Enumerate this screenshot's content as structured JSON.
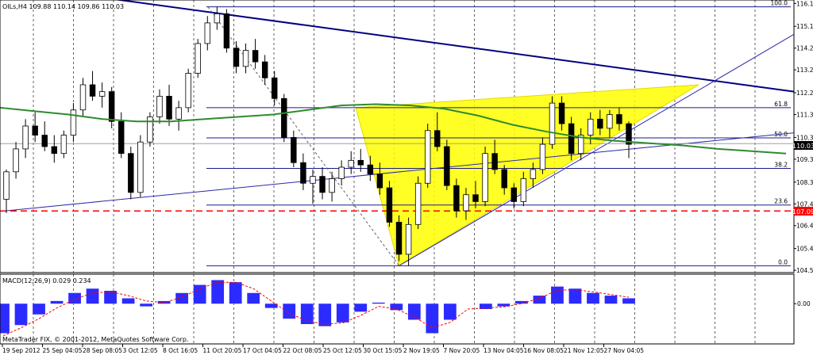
{
  "chart_data": [
    {
      "type": "candlestick",
      "title": "OILs,H4  109.88 110.14 109.86 110.03",
      "watermark": "MetaTrader FIX, © 2001-2012, MetaQuotes Software Corp.",
      "ylim": [
        104.4,
        116.3
      ],
      "y_ticks": [
        "116.15",
        "115.15",
        "114.20",
        "113.25",
        "112.25",
        "111.30",
        "110.30",
        "109.35",
        "108.35",
        "107.40",
        "106.45",
        "105.45",
        "104.50"
      ],
      "x_ticks": [
        "19 Sep 2012",
        "25 Sep 04:05",
        "28 Sep 08:05",
        "3 Oct 12:05",
        "8 Oct 16:05",
        "11 Oct 20:05",
        "17 Oct 04:05",
        "22 Oct 08:05",
        "25 Oct 12:05",
        "30 Oct 15:05",
        "2 Nov 19:05",
        "7 Nov 20:05",
        "13 Nov 04:05",
        "16 Nov 08:05",
        "21 Nov 12:05",
        "27 Nov 04:05"
      ],
      "current_price": {
        "value": 110.03,
        "label": "110.03"
      },
      "support_line": {
        "value": 107.09,
        "label": "107.09",
        "color": "#ff0000"
      },
      "moving_average": {
        "color": "#2e8b2e",
        "values": [
          111.6,
          111.45,
          111.3,
          111.1,
          111.0,
          111.0,
          111.1,
          111.2,
          111.3,
          111.5,
          111.7,
          111.75,
          111.7,
          111.55,
          111.25,
          110.85,
          110.55,
          110.3,
          110.15,
          110.05,
          109.95,
          109.8,
          109.7,
          109.6
        ]
      },
      "fibonacci": [
        {
          "level": "100.0",
          "price": 116.0
        },
        {
          "level": "61.8",
          "price": 111.6
        },
        {
          "level": "50.0",
          "price": 110.28
        },
        {
          "level": "38.2",
          "price": 108.95
        },
        {
          "level": "23.6",
          "price": 107.35
        },
        {
          "level": "0.0",
          "price": 104.7
        }
      ],
      "series": [
        {
          "values": [
            [
              107.6,
              108.9,
              107.0,
              108.8
            ],
            [
              108.8,
              110.1,
              108.5,
              109.8
            ],
            [
              109.8,
              111.1,
              109.4,
              110.8
            ],
            [
              110.8,
              111.4,
              110.1,
              110.4
            ],
            [
              110.4,
              111.0,
              109.7,
              109.9
            ],
            [
              109.9,
              110.4,
              109.2,
              109.6
            ],
            [
              109.6,
              110.6,
              109.4,
              110.4
            ],
            [
              110.4,
              111.8,
              110.1,
              111.5
            ],
            [
              111.5,
              112.9,
              111.2,
              112.6
            ],
            [
              112.6,
              113.2,
              111.9,
              112.1
            ],
            [
              112.1,
              112.7,
              111.6,
              112.3
            ],
            [
              112.3,
              112.5,
              110.7,
              111.0
            ],
            [
              111.0,
              111.4,
              109.4,
              109.6
            ],
            [
              109.6,
              109.9,
              107.6,
              107.9
            ],
            [
              107.9,
              110.4,
              107.7,
              110.1
            ],
            [
              110.1,
              111.4,
              109.9,
              111.2
            ],
            [
              111.2,
              112.4,
              110.9,
              112.1
            ],
            [
              112.1,
              112.6,
              110.8,
              111.1
            ],
            [
              111.1,
              111.9,
              110.6,
              111.6
            ],
            [
              111.6,
              113.3,
              111.4,
              113.1
            ],
            [
              113.1,
              114.6,
              112.9,
              114.4
            ],
            [
              114.4,
              115.6,
              114.1,
              115.3
            ],
            [
              115.3,
              116.0,
              115.0,
              115.7
            ],
            [
              115.7,
              115.9,
              114.0,
              114.2
            ],
            [
              114.2,
              114.5,
              113.1,
              113.4
            ],
            [
              113.4,
              114.4,
              113.1,
              114.1
            ],
            [
              114.1,
              114.6,
              113.3,
              113.6
            ],
            [
              113.6,
              113.9,
              112.6,
              112.9
            ],
            [
              112.9,
              113.2,
              111.7,
              112.0
            ],
            [
              112.0,
              112.2,
              110.1,
              110.3
            ],
            [
              110.3,
              110.6,
              109.0,
              109.2
            ],
            [
              109.2,
              109.6,
              108.0,
              108.3
            ],
            [
              108.3,
              108.9,
              107.4,
              108.6
            ],
            [
              108.6,
              109.0,
              107.6,
              107.9
            ],
            [
              107.9,
              108.8,
              107.5,
              108.5
            ],
            [
              108.5,
              109.3,
              108.2,
              109.0
            ],
            [
              109.0,
              109.7,
              108.7,
              109.3
            ],
            [
              109.3,
              109.8,
              108.8,
              109.1
            ],
            [
              109.1,
              109.5,
              108.4,
              108.7
            ],
            [
              108.7,
              109.2,
              107.8,
              108.1
            ],
            [
              108.1,
              108.4,
              106.4,
              106.6
            ],
            [
              106.6,
              106.9,
              104.9,
              105.2
            ],
            [
              105.2,
              106.8,
              104.7,
              106.5
            ],
            [
              106.5,
              108.6,
              106.3,
              108.3
            ],
            [
              108.3,
              110.9,
              108.1,
              110.6
            ],
            [
              110.6,
              111.4,
              109.7,
              109.9
            ],
            [
              109.9,
              110.2,
              108.0,
              108.2
            ],
            [
              108.2,
              108.5,
              106.8,
              107.1
            ],
            [
              107.1,
              108.1,
              106.7,
              107.8
            ],
            [
              107.8,
              108.4,
              107.2,
              107.5
            ],
            [
              107.5,
              109.9,
              107.3,
              109.6
            ],
            [
              109.6,
              110.2,
              108.7,
              108.9
            ],
            [
              108.9,
              109.1,
              107.8,
              108.1
            ],
            [
              108.1,
              108.3,
              107.2,
              107.5
            ],
            [
              107.5,
              108.8,
              107.3,
              108.5
            ],
            [
              108.5,
              109.2,
              108.1,
              108.9
            ],
            [
              108.9,
              110.3,
              108.7,
              110.0
            ],
            [
              110.0,
              112.1,
              109.8,
              111.8
            ],
            [
              111.8,
              112.1,
              110.6,
              110.9
            ],
            [
              110.9,
              111.2,
              109.3,
              109.6
            ],
            [
              109.6,
              110.7,
              109.3,
              110.4
            ],
            [
              110.4,
              111.4,
              110.0,
              111.1
            ],
            [
              111.1,
              111.5,
              110.4,
              110.7
            ],
            [
              110.7,
              111.5,
              110.3,
              111.3
            ],
            [
              111.3,
              111.6,
              110.6,
              110.9
            ],
            [
              110.9,
              111.0,
              109.4,
              110.0
            ]
          ]
        }
      ]
    },
    {
      "type": "bar",
      "title": "MACD(12,26,9) 0.029 0.234",
      "ylim": [
        -0.75,
        0.55
      ],
      "y_ticks": [
        "0.00"
      ],
      "histogram": {
        "color": "#2b2bff",
        "values": [
          -0.55,
          -0.4,
          -0.2,
          0.05,
          0.2,
          0.28,
          0.24,
          0.1,
          -0.05,
          0.05,
          0.2,
          0.35,
          0.44,
          0.4,
          0.2,
          -0.08,
          -0.28,
          -0.38,
          -0.42,
          -0.35,
          -0.15,
          0.02,
          -0.12,
          -0.3,
          -0.55,
          -0.3,
          0.0,
          -0.1,
          -0.05,
          0.05,
          0.15,
          0.32,
          0.28,
          0.2,
          0.15,
          0.1
        ]
      },
      "signal": {
        "color": "#ff0000",
        "values": [
          -0.6,
          -0.45,
          -0.28,
          -0.08,
          0.08,
          0.2,
          0.22,
          0.15,
          0.05,
          0.02,
          0.12,
          0.28,
          0.4,
          0.4,
          0.28,
          0.05,
          -0.18,
          -0.32,
          -0.38,
          -0.36,
          -0.22,
          -0.05,
          -0.1,
          -0.25,
          -0.45,
          -0.35,
          -0.1,
          -0.08,
          -0.06,
          0.0,
          0.1,
          0.25,
          0.26,
          0.22,
          0.17,
          0.12
        ]
      }
    }
  ]
}
